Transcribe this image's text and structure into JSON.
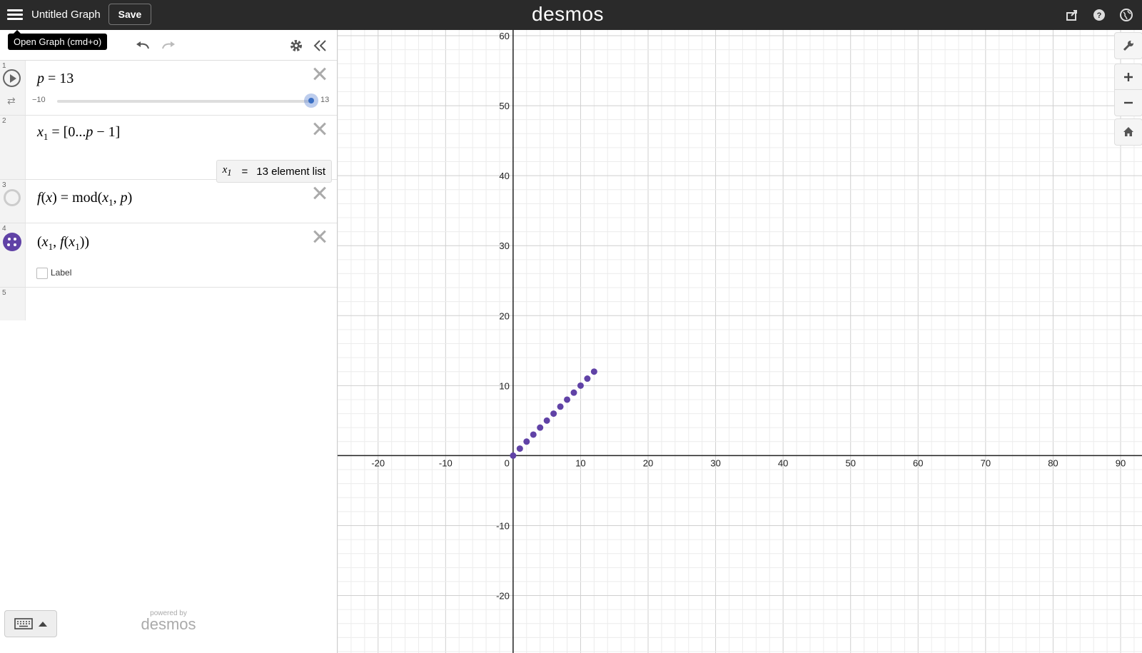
{
  "header": {
    "graph_title": "Untitled Graph",
    "save_label": "Save",
    "logo_text": "desmos",
    "icons": [
      "share-icon",
      "help-icon",
      "globe-icon"
    ]
  },
  "tooltip": {
    "text": "Open Graph (cmd+o)"
  },
  "toolbar": {
    "icons": [
      "undo-icon",
      "redo-icon",
      "settings-icon",
      "collapse-icon"
    ]
  },
  "expressions": [
    {
      "index": "1",
      "latex": "p = 13",
      "slider": {
        "min": "−10",
        "max": "13",
        "value": 13
      }
    },
    {
      "index": "2",
      "latex": "x_1 = [0...p − 1]",
      "evaluation": {
        "var": "x",
        "sub": "1",
        "eq": "=",
        "text": "13 element list"
      }
    },
    {
      "index": "3",
      "latex": "f(x) = mod(x_1, p)"
    },
    {
      "index": "4",
      "latex": "(x_1, f(x_1))",
      "label_text": "Label"
    },
    {
      "index": "5"
    }
  ],
  "footer": {
    "powered_small": "powered by",
    "powered_logo": "desmos"
  },
  "graph_controls": [
    "wrench-icon",
    "zoom-in-icon",
    "zoom-out-icon",
    "home-icon"
  ],
  "chart_data": {
    "type": "scatter",
    "x_ticks": [
      -20,
      -10,
      0,
      10,
      20,
      30,
      40,
      50,
      60,
      70,
      80,
      90
    ],
    "y_ticks": [
      -20,
      -10,
      10,
      20,
      30,
      40,
      50,
      60
    ],
    "xlim": [
      -26,
      90
    ],
    "ylim": [
      -28,
      60
    ],
    "grid": true,
    "series": [
      {
        "color": "#6042a6",
        "x": [
          0,
          1,
          2,
          3,
          4,
          5,
          6,
          7,
          8,
          9,
          10,
          11,
          12
        ],
        "y": [
          0,
          1,
          2,
          3,
          4,
          5,
          6,
          7,
          8,
          9,
          10,
          11,
          12
        ]
      }
    ]
  }
}
